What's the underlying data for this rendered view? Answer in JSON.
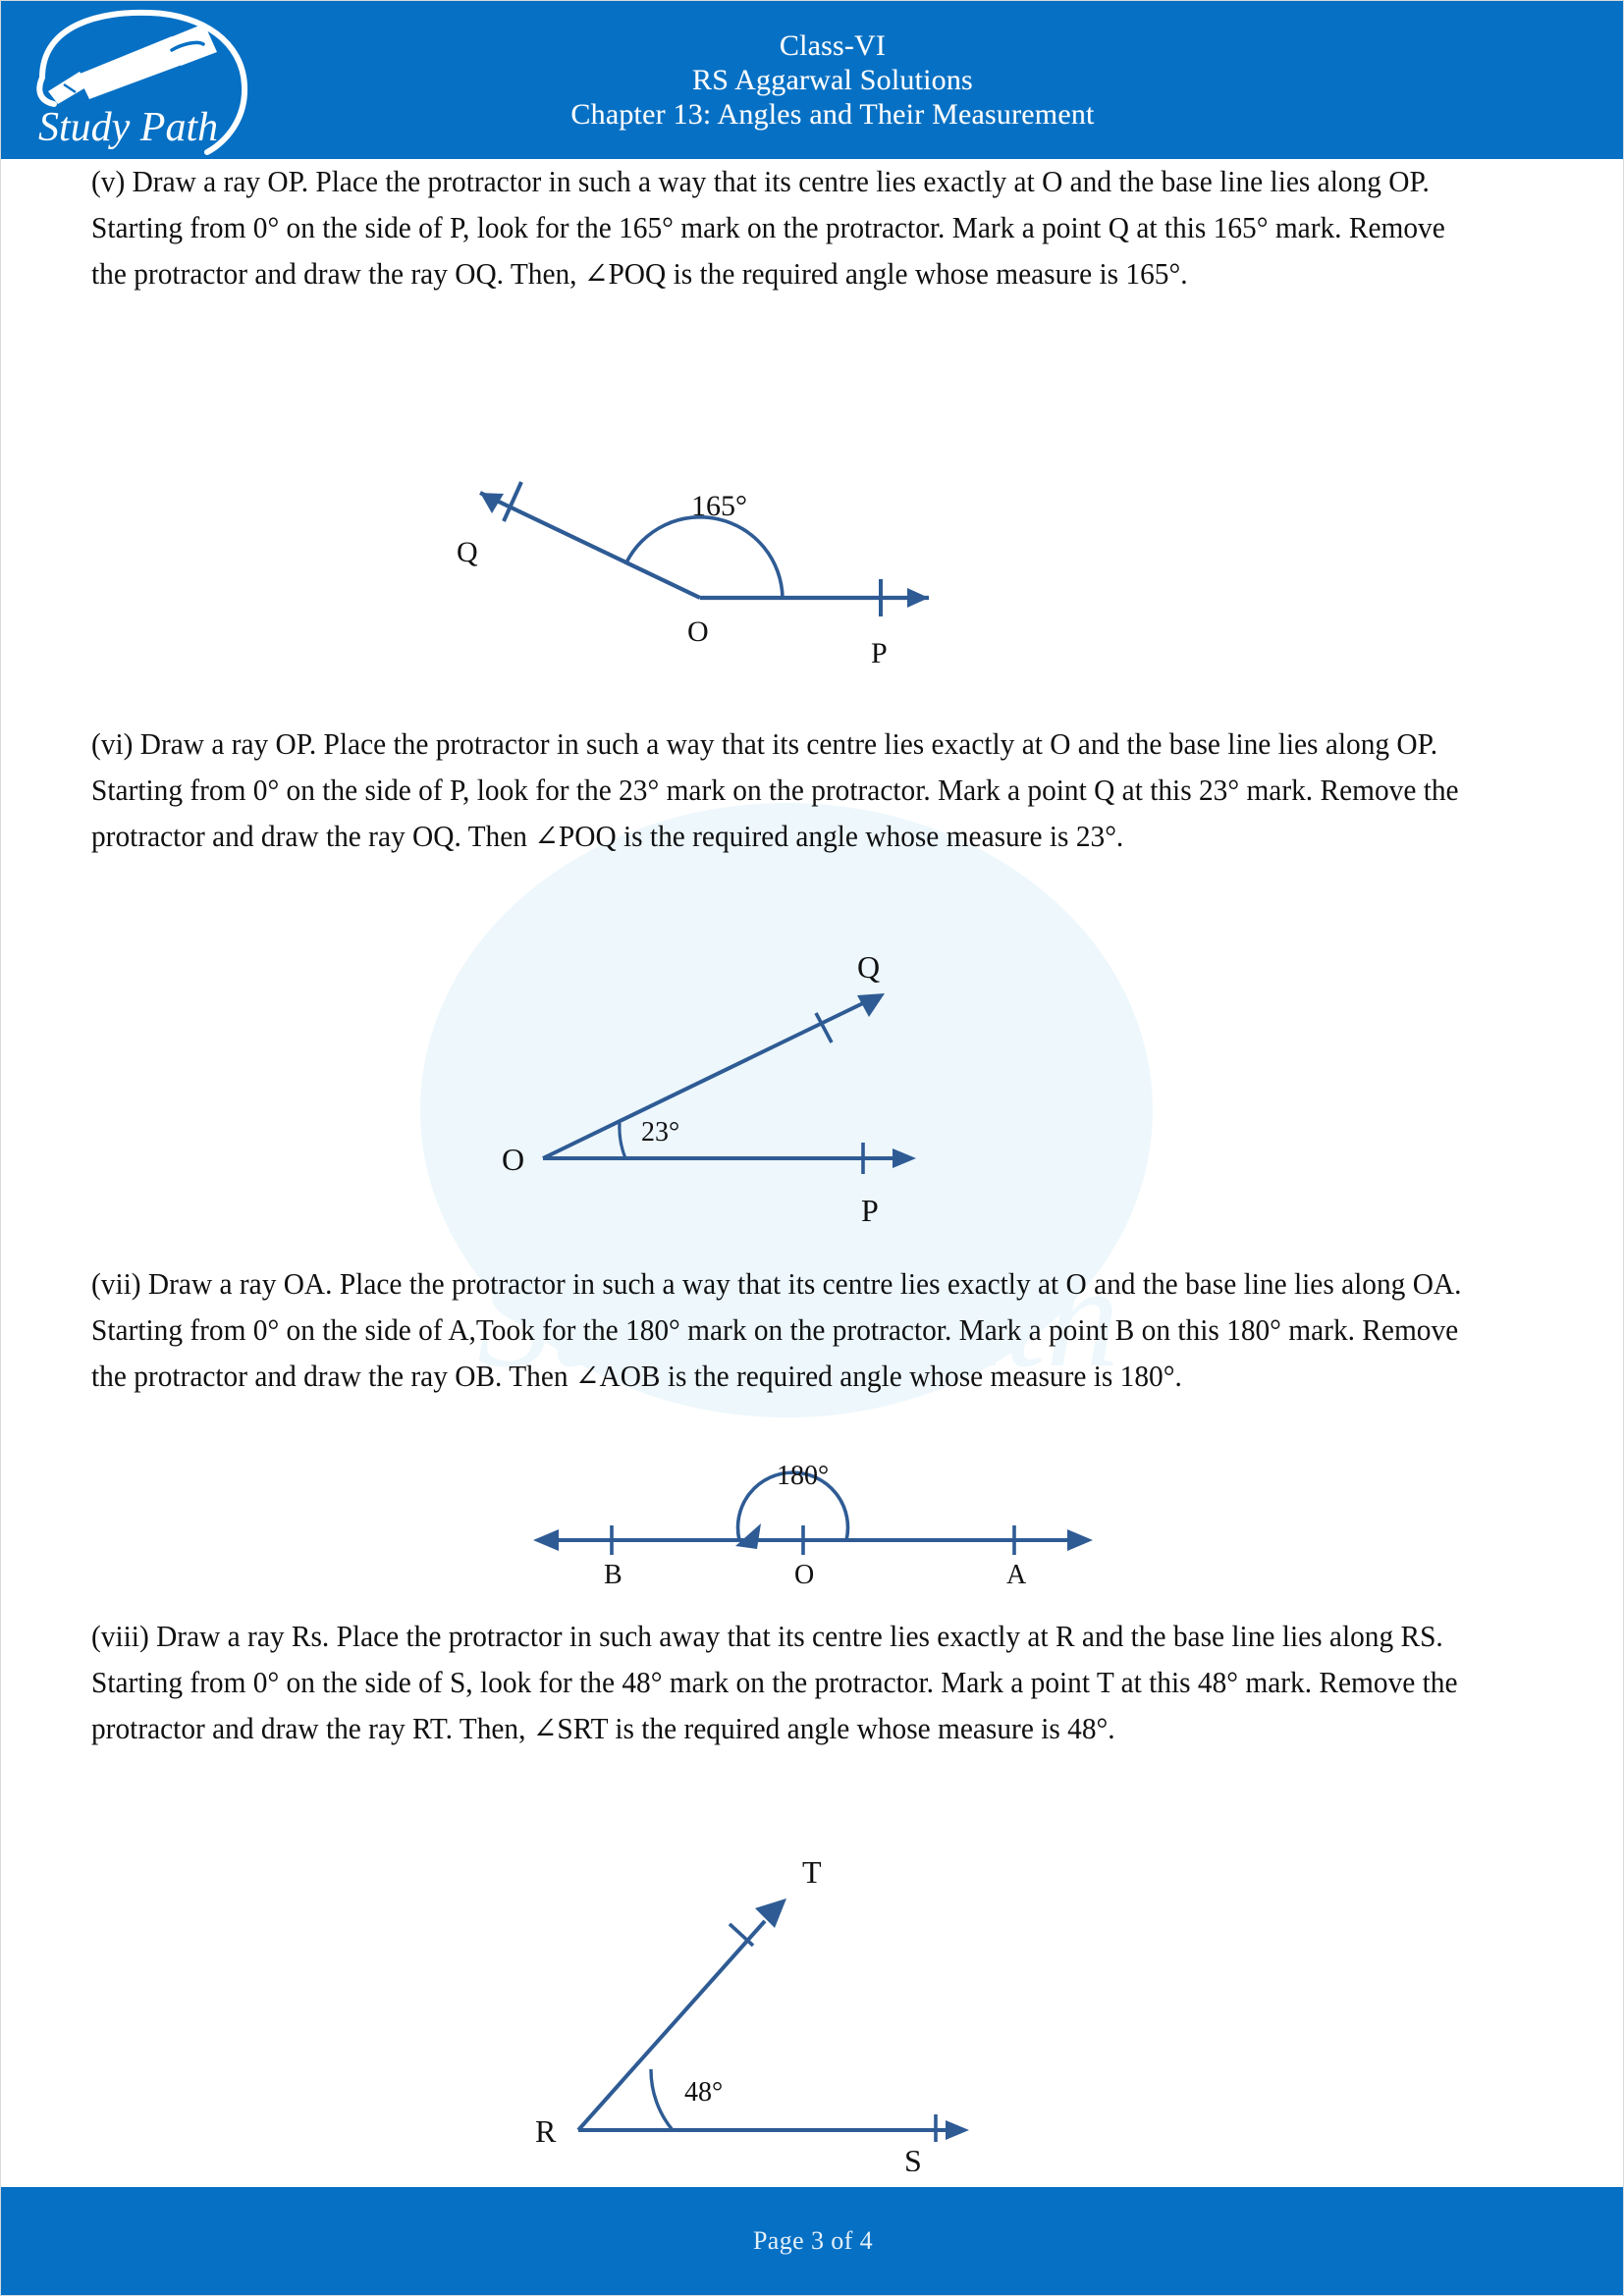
{
  "header": {
    "logo_name": "study-path-logo",
    "logo_text": "Study Path",
    "line1": "Class-VI",
    "line2": "RS Aggarwal Solutions",
    "line3": "Chapter 13: Angles and Their Measurement",
    "background_color": "#0670C4",
    "text_color": "#FFFFFF"
  },
  "footer": {
    "page_text": "Page 3 of 4",
    "background_color": "#0670C4",
    "text_color": "#E6F2FB"
  },
  "theme": {
    "diagram_line_color": "#2E5B94",
    "diagram_label_color": "#111111",
    "watermark_color": "#DCF0FB"
  },
  "body": {
    "paragraphs": [
      {
        "id": "v",
        "text": "(v) Draw a ray OP. Place the protractor in such a way that its centre lies exactly at O and the base line lies along OP. Starting from 0° on the side of P, look for the 165° mark on the protractor. Mark a point Q at this 165° mark. Remove the protractor and draw the ray OQ. Then, ∠POQ is the required angle whose measure is 165°."
      },
      {
        "id": "vi",
        "text": "(vi) Draw a ray OP. Place the protractor in such a way that its centre lies exactly at O and the base line lies along OP. Starting from 0° on the side of P, look for the 23° mark on the protractor. Mark a point Q at this 23° mark. Remove the protractor and draw the ray OQ. Then ∠POQ is the required angle whose measure is 23°."
      },
      {
        "id": "vii",
        "text": "(vii) Draw a ray OA. Place the protractor in such a way that its centre lies exactly at O and the base line lies along OA. Starting from 0° on the side of A,Took for the 180° mark on the protractor. Mark a point B on this 180° mark. Remove the protractor and draw the ray OB. Then ∠AOB is the required angle whose measure is 180°."
      },
      {
        "id": "viii",
        "text": "(viii) Draw a ray Rs. Place the protractor in such away that its centre lies exactly at R and the base line lies along RS. Starting from 0° on the side of S, look for the 48° mark on the protractor. Mark a point T at this 48° mark. Remove the protractor and draw the ray RT. Then, ∠SRT is the required angle whose measure is 48°."
      }
    ],
    "figures": [
      {
        "id": "fig-165",
        "angle_label": "165°",
        "vertex_label": "O",
        "ray1_label": "P",
        "ray2_label": "Q"
      },
      {
        "id": "fig-23",
        "angle_label": "23°",
        "vertex_label": "O",
        "ray1_label": "P",
        "ray2_label": "Q"
      },
      {
        "id": "fig-180",
        "angle_label": "180°",
        "vertex_label": "O",
        "ray1_label": "A",
        "ray2_label": "B"
      },
      {
        "id": "fig-48",
        "angle_label": "48°",
        "vertex_label": "R",
        "ray1_label": "S",
        "ray2_label": "T"
      }
    ]
  }
}
